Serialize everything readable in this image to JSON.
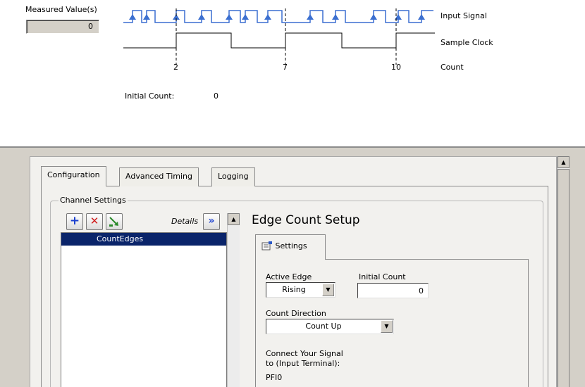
{
  "diagram": {
    "measured_label": "Measured Value(s)",
    "measured_value": "0",
    "signal_labels": [
      "Input Signal",
      "Sample Clock",
      "Count"
    ],
    "count_marks": [
      "2",
      "7",
      "10"
    ],
    "initial_count_label": "Initial Count:",
    "initial_count_value": "0",
    "accent_color": "#3b6fd0"
  },
  "tabs": [
    {
      "label": "Configuration",
      "active": true
    },
    {
      "label": "Advanced Timing",
      "active": false
    },
    {
      "label": "Logging",
      "active": false
    }
  ],
  "channel_settings": {
    "legend": "Channel Settings",
    "toolbar": {
      "add_icon": "plus-icon",
      "remove_icon": "x-icon",
      "rename_icon": "rename-icon",
      "details_label": "Details",
      "details_icon": "double-chevron-right-icon"
    },
    "channels": [
      "CountEdges"
    ]
  },
  "setup": {
    "title": "Edge Count Setup",
    "settings_tab": "Settings",
    "active_edge_label": "Active Edge",
    "active_edge_value": "Rising",
    "initial_count_label": "Initial Count",
    "initial_count_value": "0",
    "count_direction_label": "Count Direction",
    "count_direction_value": "Count Up",
    "terminal_label_line1": "Connect Your Signal",
    "terminal_label_line2": "to (Input Terminal):",
    "terminal_value": "PFI0"
  }
}
